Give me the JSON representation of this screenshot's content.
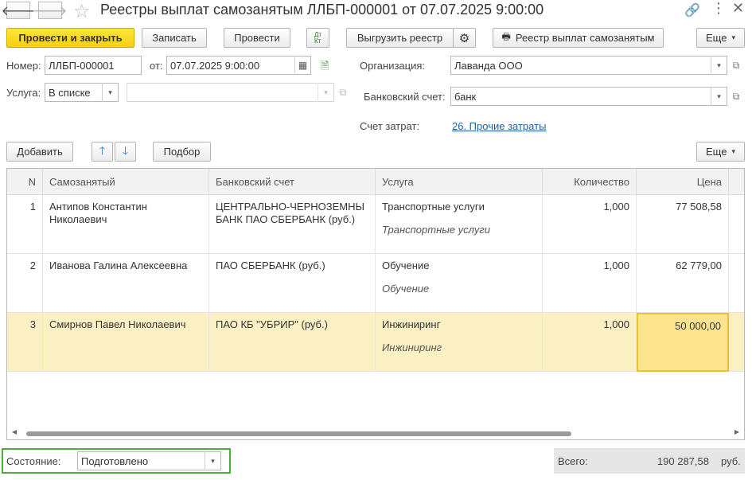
{
  "window": {
    "title": "Реестры выплат самозанятым ЛЛБП-000001 от 07.07.2025 9:00:00",
    "back_icon": "arrow-left-icon",
    "forward_icon": "arrow-right-icon",
    "favorite_icon": "star-icon"
  },
  "toolbar": {
    "post_and_close": "Провести и закрыть",
    "save": "Записать",
    "post": "Провести",
    "dt_kt": "Дт Кт",
    "export": "Выгрузить реестр",
    "print_registry": "Реестр выплат самозанятым",
    "more": "Еще"
  },
  "form": {
    "number_label": "Номер:",
    "number_value": "ЛЛБП-000001",
    "from_label": "от:",
    "date_value": "07.07.2025  9:00:00",
    "org_label": "Организация:",
    "org_value": "Лаванда ООО",
    "service_label": "Услуга:",
    "service_mode": "В списке",
    "service_value": "",
    "bank_label": "Банковский счет:",
    "bank_value": "банк",
    "cost_account_label": "Счет затрат:",
    "cost_account_value": "26. Прочие затраты"
  },
  "table_toolbar": {
    "add": "Добавить",
    "pick": "Подбор",
    "more": "Еще"
  },
  "table": {
    "headers": [
      "N",
      "Самозанятый",
      "Банковский счет",
      "Услуга",
      "Количество",
      "Цена"
    ],
    "rows": [
      {
        "n": "1",
        "person": "Антипов Константин Николаевич",
        "bank": "ЦЕНТРАЛЬНО-ЧЕРНОЗЕМНЫ БАНК ПАО СБЕРБАНК (руб.)",
        "service": "Транспортные услуги",
        "service_sub": "Транспортные услуги",
        "qty": "1,000",
        "price": "77 508,58"
      },
      {
        "n": "2",
        "person": "Иванова Галина Алексеевна",
        "bank": "ПАО СБЕРБАНК (руб.)",
        "service": "Обучение",
        "service_sub": "Обучение",
        "qty": "1,000",
        "price": "62 779,00"
      },
      {
        "n": "3",
        "person": "Смирнов Павел Николаевич",
        "bank": "ПАО КБ \"УБРИР\" (руб.)",
        "service": "Инжиниринг",
        "service_sub": "Инжиниринг",
        "qty": "1,000",
        "price": "50 000,00"
      }
    ]
  },
  "footer": {
    "state_label": "Состояние:",
    "state_value": "Подготовлено",
    "total_label": "Всего:",
    "total_value": "190 287,58",
    "currency": "руб."
  },
  "colors": {
    "accent_yellow": "#f5cf13",
    "selected_row": "#fbf0c4",
    "selected_cell": "#fde590",
    "link": "#1f5fa8",
    "state_highlight": "#4caf3a"
  }
}
